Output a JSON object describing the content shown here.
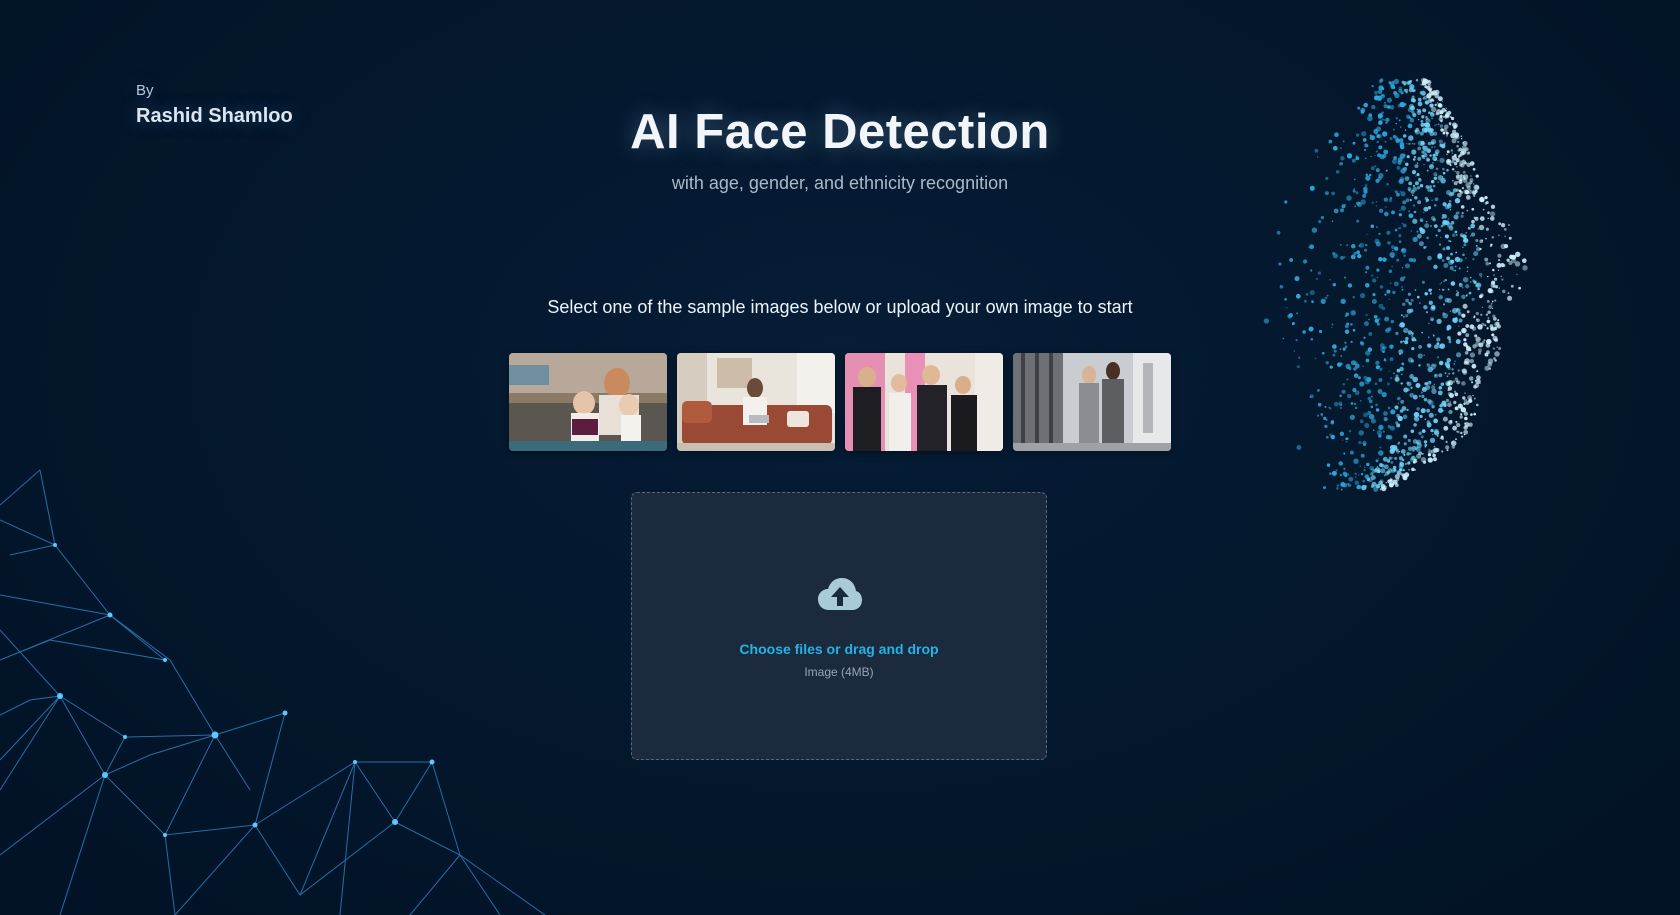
{
  "author": {
    "by_label": "By",
    "name": "Rashid Shamloo"
  },
  "header": {
    "title": "AI Face Detection",
    "subtitle": "with age, gender, and ethnicity recognition"
  },
  "main": {
    "instruction": "Select one of the sample images below or upload your own image to start",
    "sample_images": [
      {
        "name": "family-on-couch"
      },
      {
        "name": "woman-with-laptop-on-sofa"
      },
      {
        "name": "group-of-business-people"
      },
      {
        "name": "two-people-in-hallway"
      }
    ],
    "upload": {
      "label": "Choose files or drag and drop",
      "hint": "Image (4MB)",
      "icon": "cloud-upload-icon"
    }
  },
  "colors": {
    "background": "#03162b",
    "accent": "#24b3e6",
    "dropzone": "#1b2a3d"
  }
}
